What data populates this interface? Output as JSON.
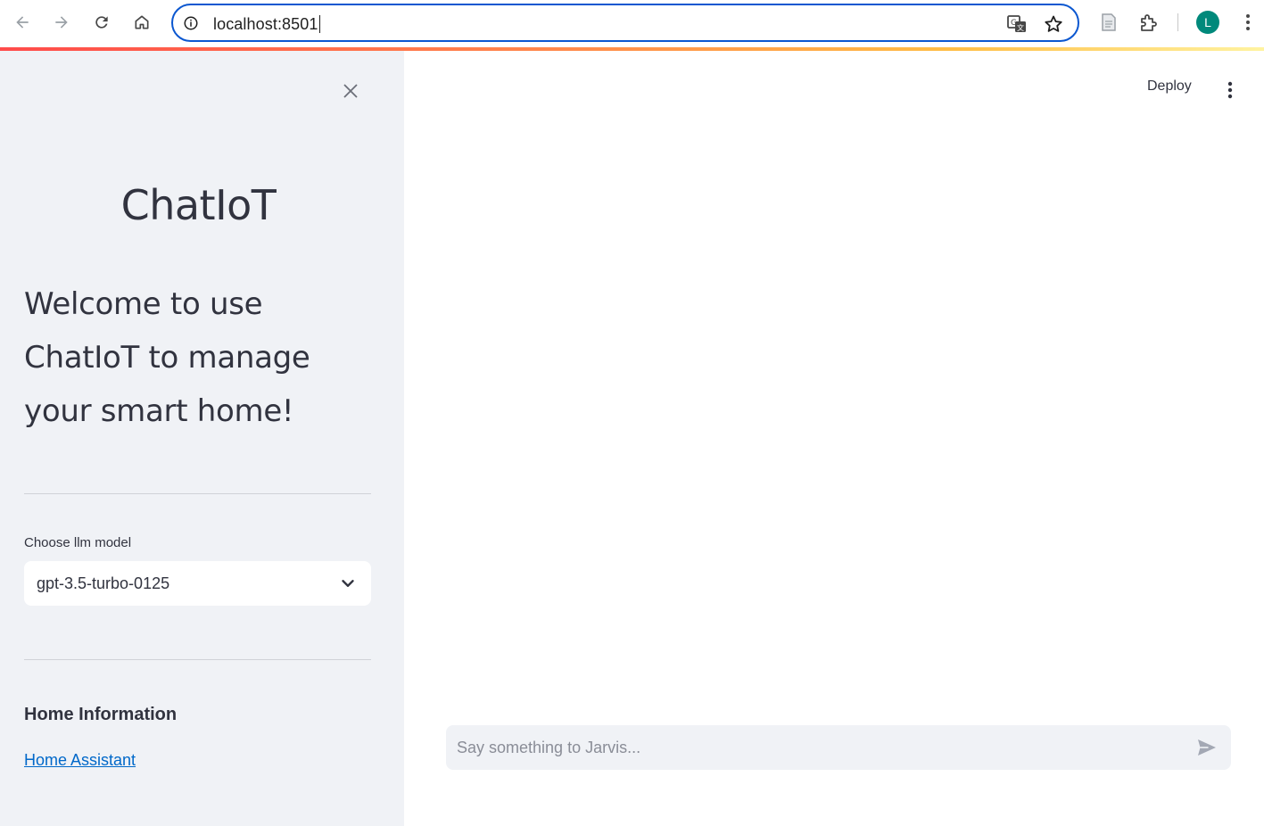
{
  "browser": {
    "url": "localhost:8501",
    "avatar_initial": "L",
    "icons": [
      "back-arrow-icon",
      "forward-arrow-icon",
      "reload-icon",
      "home-icon",
      "info-icon",
      "translate-icon",
      "star-icon",
      "reading-list-icon",
      "extensions-icon",
      "more-vert-icon"
    ]
  },
  "sidebar": {
    "title": "ChatIoT",
    "welcome": "Welcome to use ChatIoT to manage your smart home!",
    "model_select": {
      "label": "Choose llm model",
      "selected": "gpt-3.5-turbo-0125"
    },
    "home_info_heading": "Home Information",
    "home_assistant_link": "Home Assistant"
  },
  "main": {
    "deploy_label": "Deploy",
    "chat_placeholder": "Say something to Jarvis..."
  },
  "colors": {
    "sidebar_bg": "#f0f2f6",
    "text": "#31333f",
    "link": "#0068c9",
    "omnibox_border": "#0b57d0",
    "avatar": "#00897b",
    "accent_start": "#ff4b4b",
    "accent_end": "#fff3a0"
  }
}
